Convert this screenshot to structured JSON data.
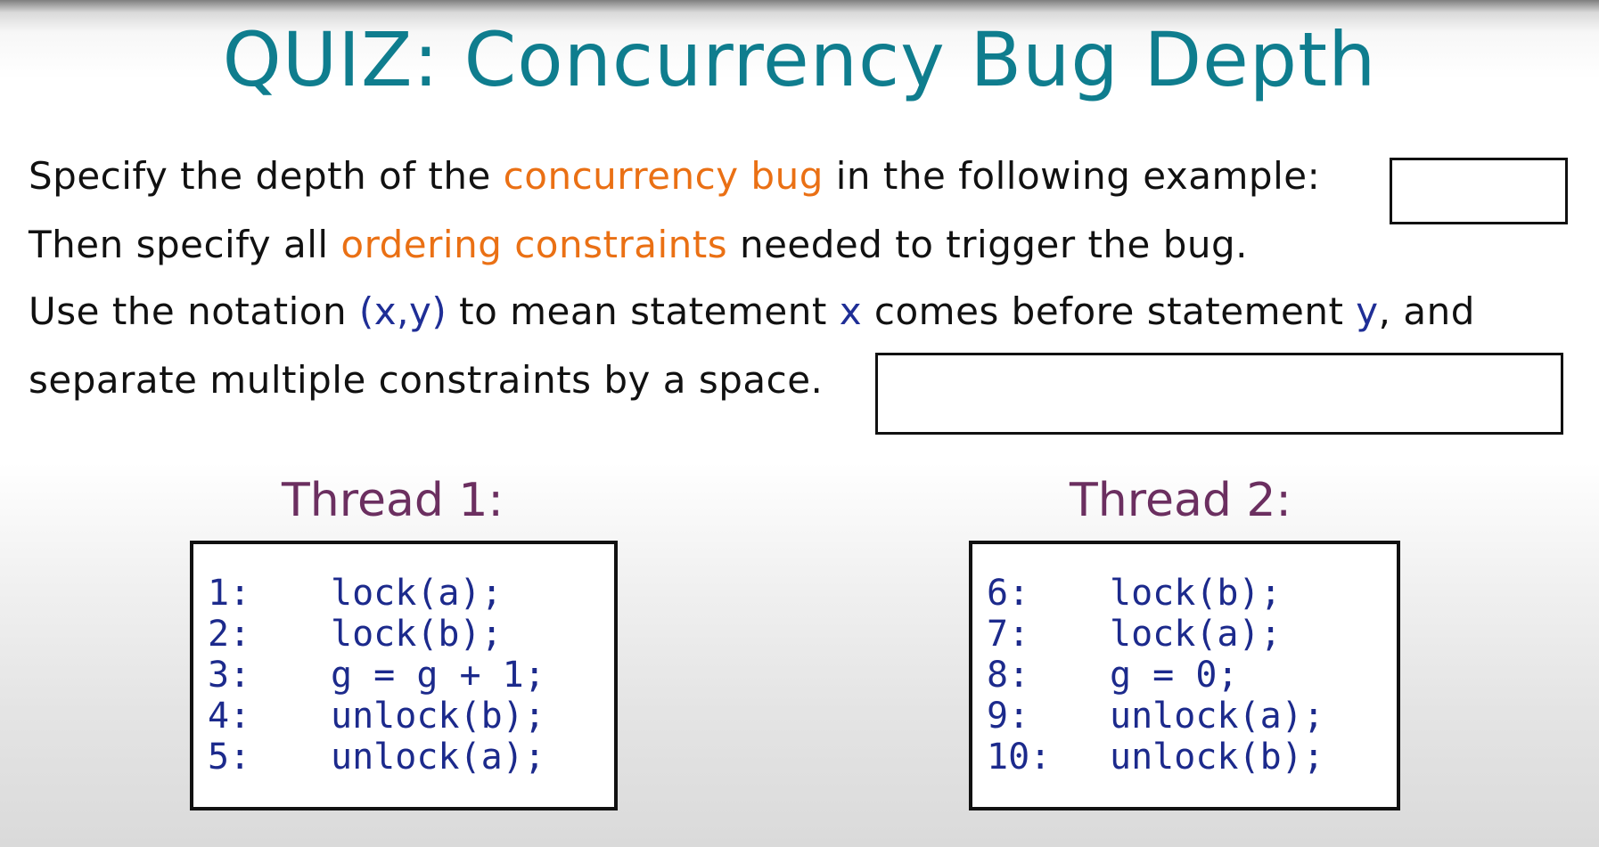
{
  "title": "QUIZ: Concurrency Bug Depth",
  "instructions": {
    "line1": {
      "before": "Specify the depth of the ",
      "highlight": "concurrency bug",
      "after": " in the following example:"
    },
    "line2": {
      "before": "Then specify all ",
      "highlight": "ordering constraints",
      "after": " needed to trigger the bug."
    },
    "line3": {
      "part1": "Use the notation ",
      "notation": "(x,y)",
      "part2": " to mean statement ",
      "x": "x",
      "part3": " comes before statement ",
      "y": "y",
      "part4": ", and"
    },
    "line4": "separate multiple constraints by a space."
  },
  "threads": [
    {
      "label": "Thread 1:",
      "lines": [
        {
          "num": "1:",
          "code": "lock(a);"
        },
        {
          "num": "2:",
          "code": "lock(b);"
        },
        {
          "num": "3:",
          "code": "g = g + 1;"
        },
        {
          "num": "4:",
          "code": "unlock(b);"
        },
        {
          "num": "5:",
          "code": "unlock(a);"
        }
      ]
    },
    {
      "label": "Thread 2:",
      "lines": [
        {
          "num": "6:",
          "code": "lock(b);"
        },
        {
          "num": "7:",
          "code": "lock(a);"
        },
        {
          "num": "8:",
          "code": "g = 0;"
        },
        {
          "num": "9:",
          "code": "unlock(a);"
        },
        {
          "num": "10:",
          "code": "unlock(b);"
        }
      ]
    }
  ],
  "colors": {
    "title": "#0f7d8e",
    "highlight": "#ea7014",
    "notation": "#1f2e96",
    "thread_label": "#6b2f60",
    "code": "#1c2a8c"
  }
}
